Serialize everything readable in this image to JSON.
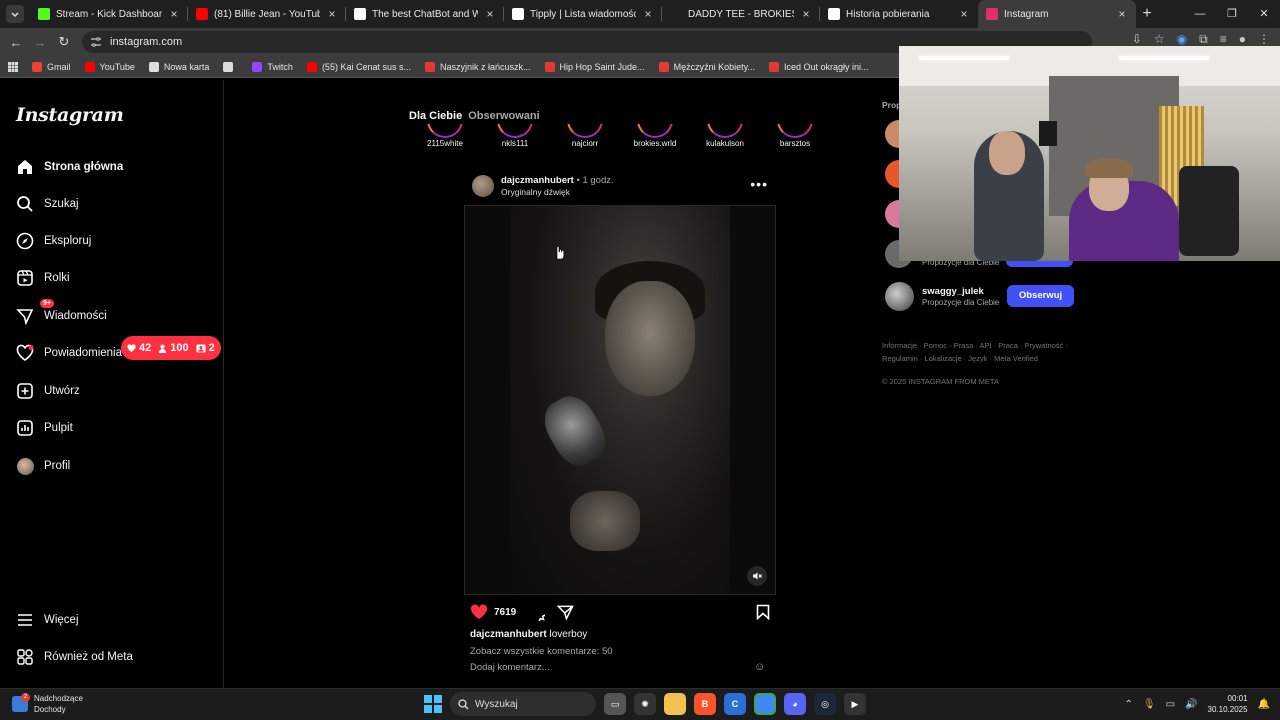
{
  "browser": {
    "tabs": [
      {
        "title": "Stream - Kick Dashboard",
        "icon": "kick-icon",
        "color": "#53fc18",
        "active": false
      },
      {
        "title": "(81) Billie Jean - YouTube",
        "icon": "youtube-icon",
        "color": "#ff0000",
        "active": false
      },
      {
        "title": "The best ChatBot and Widgets",
        "icon": "chatbot-icon",
        "color": "#ffffff",
        "active": false
      },
      {
        "title": "Tipply | Lista wiadomości",
        "icon": "tipply-icon",
        "color": "#ffffff",
        "active": false
      },
      {
        "title": "DADDY TEE - BROKIES",
        "icon": "blank-icon",
        "color": "#1f1f1f",
        "active": false
      },
      {
        "title": "Historia pobierania",
        "icon": "download-icon",
        "color": "#ffffff",
        "active": false
      },
      {
        "title": "Instagram",
        "icon": "instagram-icon",
        "color": "#e1306c",
        "active": true
      }
    ],
    "url": "instagram.com",
    "bookmarks": [
      {
        "label": "Gmail",
        "color": "#ea4335"
      },
      {
        "label": "YouTube",
        "color": "#ff0000"
      },
      {
        "label": "Nowa karta",
        "color": "#dddddd"
      },
      {
        "label": "",
        "color": "#dddddd"
      },
      {
        "label": "Twitch",
        "color": "#9146ff"
      },
      {
        "label": "(55) Kai Cenat sus s...",
        "color": "#ff0000"
      },
      {
        "label": "Naszyjnik z łańcuszk...",
        "color": "#e53935"
      },
      {
        "label": "Hip Hop Saint Jude...",
        "color": "#e53935"
      },
      {
        "label": "Mężczyźni Kobiety...",
        "color": "#e53935"
      },
      {
        "label": "Iced Out okrągły ini...",
        "color": "#e53935"
      }
    ]
  },
  "instagram": {
    "logo": "Instagram",
    "nav": [
      {
        "label": "Strona główna",
        "icon": "home-icon"
      },
      {
        "label": "Szukaj",
        "icon": "search-icon"
      },
      {
        "label": "Eksploruj",
        "icon": "explore-icon"
      },
      {
        "label": "Rolki",
        "icon": "reels-icon"
      },
      {
        "label": "Wiadomości",
        "icon": "messages-icon"
      },
      {
        "label": "Powiadomienia",
        "icon": "heart-icon"
      },
      {
        "label": "Utwórz",
        "icon": "create-icon"
      },
      {
        "label": "Pulpit",
        "icon": "dashboard-icon"
      },
      {
        "label": "Profil",
        "icon": "profile-icon"
      }
    ],
    "messages_badge": "9+",
    "more": "Więcej",
    "also_meta": "Również od Meta",
    "notifications": {
      "likes": "42",
      "followers": "100",
      "requests": "2"
    },
    "feed_tabs": {
      "for_you": "Dla Ciebie",
      "following": "Obserwowani"
    },
    "stories": [
      "2115white",
      "nkls111",
      "najciorr",
      "brokies.wrld",
      "kulakulson",
      "barsztos"
    ],
    "post": {
      "username": "dajczmanhubert",
      "time": "1 godz.",
      "audio": "Oryginalny dźwięk",
      "likes": "7619",
      "caption_user": "dajczmanhubert",
      "caption_text": "loverboy",
      "view_comments": "Zobacz wszystkie komentarze: 50",
      "add_comment": "Dodaj komentarz..."
    },
    "suggestions": {
      "title": "Prop",
      "partial_sub": "Propozycje dla Ciebie",
      "user": "swaggy_julek",
      "sub": "Propozycje dla Ciebie",
      "follow": "Obserwuj"
    },
    "footer": "Informacje · Pomoc · Prasa · API · Praca · Prywatność · Regulamin · Lokalizacje · Język · Meta Verified",
    "copyright": "© 2025 INSTAGRAM FROM META"
  },
  "taskbar": {
    "weather_title": "Nadchodzące",
    "weather_sub": "Dochody",
    "weather_badge": "2",
    "search": "Wyszukaj",
    "time": "00:01",
    "date": "30.10.2025"
  }
}
